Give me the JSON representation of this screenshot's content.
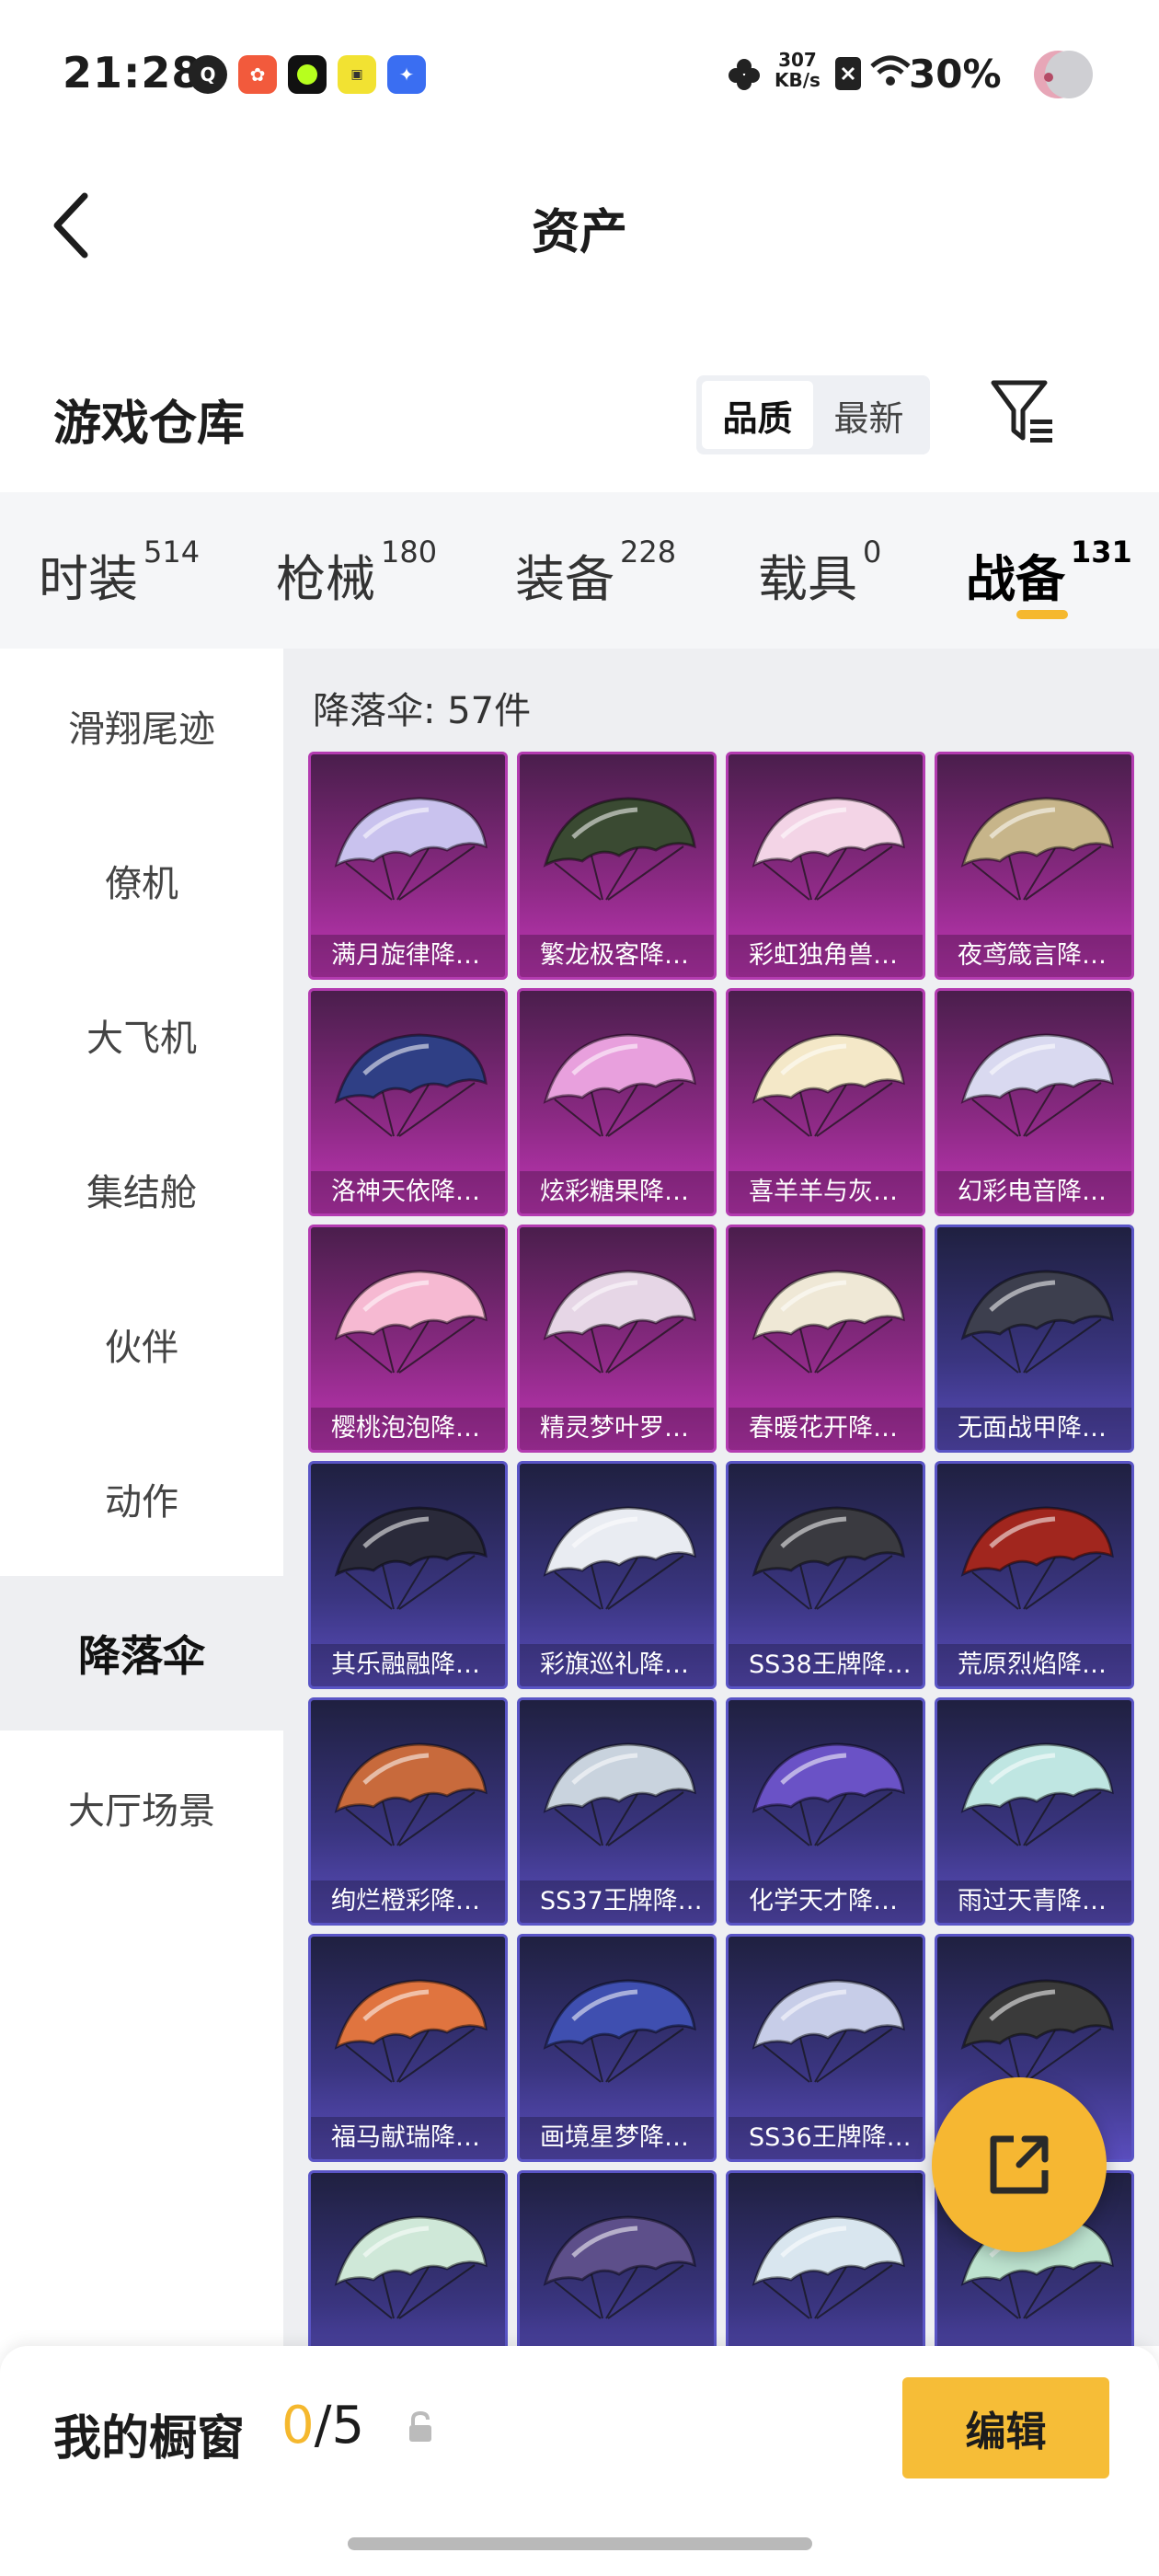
{
  "status_bar": {
    "time": "21:28",
    "net_speed_value": "307",
    "net_speed_unit": "KB/s",
    "battery": "30%"
  },
  "header": {
    "title": "资产"
  },
  "section": {
    "title": "游戏仓库",
    "sort_options": [
      "品质",
      "最新"
    ],
    "sort_selected": "品质"
  },
  "tabs": [
    {
      "label": "时装",
      "count": "514"
    },
    {
      "label": "枪械",
      "count": "180"
    },
    {
      "label": "装备",
      "count": "228"
    },
    {
      "label": "载具",
      "count": "0"
    },
    {
      "label": "战备",
      "count": "131"
    }
  ],
  "sidebar": [
    {
      "label": "滑翔尾迹"
    },
    {
      "label": "僚机"
    },
    {
      "label": "大飞机"
    },
    {
      "label": "集结舱"
    },
    {
      "label": "伙伴"
    },
    {
      "label": "动作"
    },
    {
      "label": "降落伞"
    },
    {
      "label": "大厅场景"
    }
  ],
  "content": {
    "count_label": "降落伞: 57件",
    "items": [
      {
        "name": "满月旋律降…",
        "rarity": "purple",
        "color": "#c9c2ee"
      },
      {
        "name": "繁龙极客降…",
        "rarity": "purple",
        "color": "#3a4a32"
      },
      {
        "name": "彩虹独角兽…",
        "rarity": "purple",
        "color": "#f3d4e6"
      },
      {
        "name": "夜鸢箴言降…",
        "rarity": "purple",
        "color": "#c7b58a"
      },
      {
        "name": "洛神天依降…",
        "rarity": "purple",
        "color": "#2f3f85"
      },
      {
        "name": "炫彩糖果降…",
        "rarity": "purple",
        "color": "#e8a0dd"
      },
      {
        "name": "喜羊羊与灰…",
        "rarity": "purple",
        "color": "#f4e8c8"
      },
      {
        "name": "幻彩电音降…",
        "rarity": "purple",
        "color": "#d9d9f0"
      },
      {
        "name": "樱桃泡泡降…",
        "rarity": "purple",
        "color": "#f6b9d2"
      },
      {
        "name": "精灵梦叶罗…",
        "rarity": "purple",
        "color": "#e6d6e6"
      },
      {
        "name": "春暖花开降…",
        "rarity": "purple",
        "color": "#efe8d6"
      },
      {
        "name": "无面战甲降…",
        "rarity": "blue",
        "color": "#3d3f4e"
      },
      {
        "name": "其乐融融降…",
        "rarity": "blue",
        "color": "#2a2a3a"
      },
      {
        "name": "彩旗巡礼降…",
        "rarity": "blue",
        "color": "#e9ecf2"
      },
      {
        "name": "SS38王牌降…",
        "rarity": "blue",
        "color": "#3a3a40"
      },
      {
        "name": "荒原烈焰降…",
        "rarity": "blue",
        "color": "#a1261e"
      },
      {
        "name": "绚烂橙彩降…",
        "rarity": "blue",
        "color": "#c86a3c"
      },
      {
        "name": "SS37王牌降…",
        "rarity": "blue",
        "color": "#c9d3de"
      },
      {
        "name": "化学天才降…",
        "rarity": "blue",
        "color": "#6a52c6"
      },
      {
        "name": "雨过天青降…",
        "rarity": "blue",
        "color": "#bfe6e2"
      },
      {
        "name": "福马献瑞降…",
        "rarity": "blue",
        "color": "#e0743f"
      },
      {
        "name": "画境星梦降…",
        "rarity": "blue",
        "color": "#3f4fb0"
      },
      {
        "name": "SS36王牌降…",
        "rarity": "blue",
        "color": "#c7cde8"
      },
      {
        "name": "",
        "rarity": "blue",
        "color": "#3a3a3a"
      },
      {
        "name": "",
        "rarity": "blue",
        "color": "#cfe8d8"
      },
      {
        "name": "",
        "rarity": "blue",
        "color": "#5d4f8a"
      },
      {
        "name": "",
        "rarity": "blue",
        "color": "#d9e6ef"
      },
      {
        "name": "",
        "rarity": "blue",
        "color": "#bde3cf"
      }
    ]
  },
  "bottom_bar": {
    "label": "我的橱窗",
    "count_current": "0",
    "count_total": "/5",
    "edit_label": "编辑"
  },
  "colors": {
    "accent": "#f5b82e",
    "purple_rarity": "#b33bb0",
    "blue_rarity": "#5a55c6"
  }
}
